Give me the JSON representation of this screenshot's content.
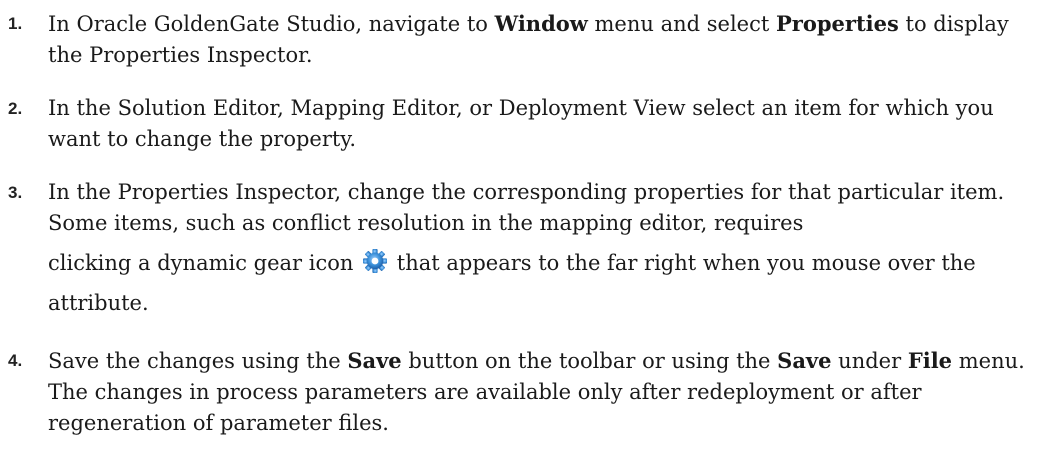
{
  "steps": [
    {
      "number": "1.",
      "t1": "In Oracle GoldenGate Studio, navigate to ",
      "b1": "Window",
      "t2": " menu and select ",
      "b2": "Properties",
      "t3": " to display the Properties Inspector."
    },
    {
      "number": "2.",
      "text": "In the Solution Editor, Mapping Editor, or Deployment View select an item for which you want to change the property."
    },
    {
      "number": "3.",
      "t1": "In the Properties Inspector, change the corresponding properties for that particular item. Some items, such as conflict resolution in the mapping editor, requires",
      "t2": "clicking a dynamic gear icon",
      "t3": "that appears to the far right when you mouse over the attribute.",
      "icon": "gear-icon",
      "icon_color": "#3a8fd8"
    },
    {
      "number": "4.",
      "t1": "Save the changes using the ",
      "b1": "Save",
      "t2": " button on the toolbar or using the ",
      "b2": "Save",
      "t3": " under ",
      "b3": "File",
      "t4": " menu. The changes in process parameters are available only after redeployment or after regeneration of parameter files."
    }
  ]
}
